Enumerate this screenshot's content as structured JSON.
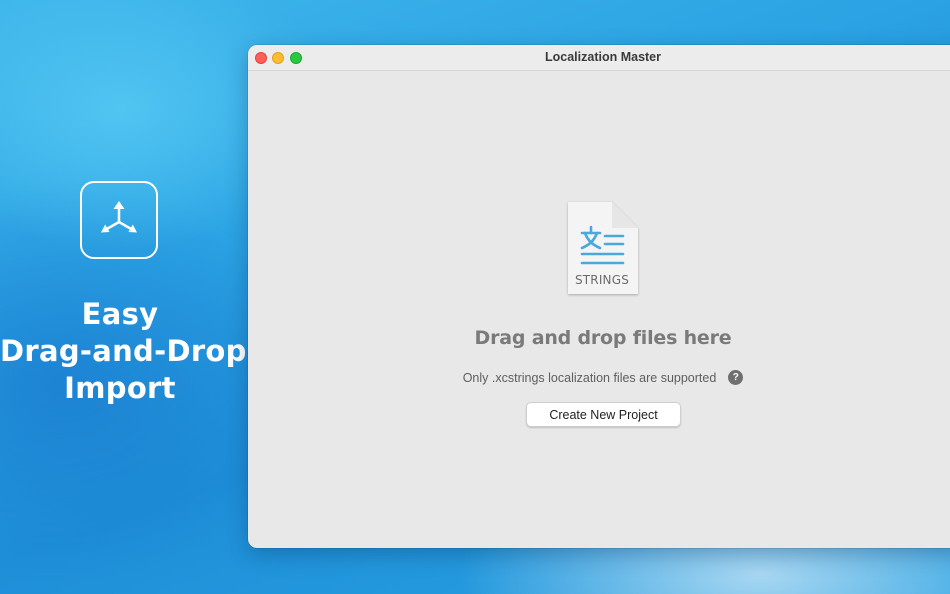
{
  "promo": {
    "icon": "drag-drop-arrows-icon",
    "headline_lines": [
      "Easy",
      "Drag-and-Drop",
      "Import"
    ]
  },
  "window": {
    "title": "Localization Master",
    "traffic_lights": {
      "close": "#ff5f57",
      "minimize": "#febc2e",
      "maximize": "#28c840"
    }
  },
  "drop_zone": {
    "file_icon": "strings-file-icon",
    "file_icon_label": "STRINGS",
    "headline": "Drag and drop files here",
    "support_text": "Only .xcstrings localization files are supported",
    "help_icon": "help-icon",
    "help_glyph": "?",
    "create_button_label": "Create New Project"
  },
  "colors": {
    "background": "#2ba3e4",
    "accent": "#4aa8dc"
  }
}
